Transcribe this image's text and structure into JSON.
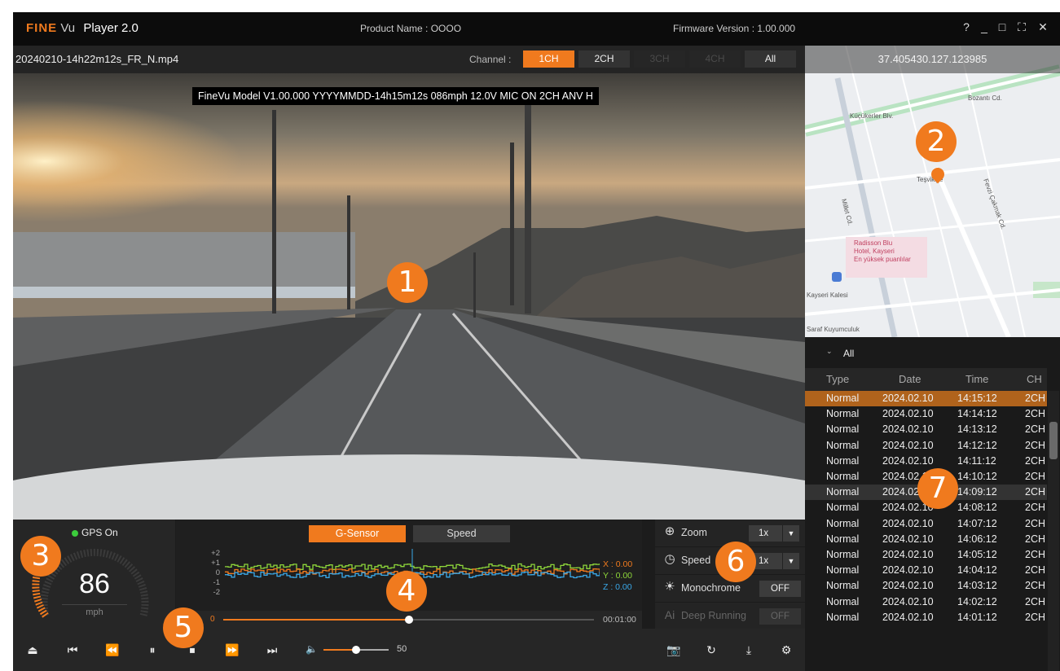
{
  "titlebar": {
    "logo_brand": "FINE",
    "logo_vu": "Vu",
    "app_name": "Player 2.0",
    "product_name": "Product Name : OOOO",
    "firmware": "Firmware Version  : 1.00.000",
    "help": "?",
    "minimize": "_",
    "maximize": "□",
    "fullscreen": "⛶",
    "close": "✕"
  },
  "filebar": {
    "filename": "20240210-14h22m12s_FR_N.mp4",
    "channel_label": "Channel  :",
    "channels": [
      "1CH",
      "2CH",
      "3CH",
      "4CH",
      "All"
    ],
    "active_channel": "1CH"
  },
  "video": {
    "osd_text": "FineVu Model V1.00.000  YYYYMMDD-14h15m12s 086mph 12.0V MIC ON 2CH ANV H"
  },
  "map": {
    "coordinates": "37.405430.127.123985",
    "labels": [
      "Bozantı Cd.",
      "Küçükerler Blv.",
      "Teşvikiye",
      "Radisson Blu",
      "Hotel, Kayseri",
      "En yüksek puanlılar",
      "Kayseri Kalesi",
      "Saraf Kuyumculuk",
      "Millet Cd.",
      "Fevzi Çakmak Cd."
    ]
  },
  "event_list": {
    "filter": "All",
    "filter_icon": "chevron-down-icon",
    "headers": [
      "Type",
      "Date",
      "Time",
      "CH"
    ],
    "rows": [
      [
        "Normal",
        "2024.02.10",
        "14:15:12",
        "2CH"
      ],
      [
        "Normal",
        "2024.02.10",
        "14:14:12",
        "2CH"
      ],
      [
        "Normal",
        "2024.02.10",
        "14:13:12",
        "2CH"
      ],
      [
        "Normal",
        "2024.02.10",
        "14:12:12",
        "2CH"
      ],
      [
        "Normal",
        "2024.02.10",
        "14:11:12",
        "2CH"
      ],
      [
        "Normal",
        "2024.02.10",
        "14:10:12",
        "2CH"
      ],
      [
        "Normal",
        "2024.02.10",
        "14:09:12",
        "2CH"
      ],
      [
        "Normal",
        "2024.02.10",
        "14:08:12",
        "2CH"
      ],
      [
        "Normal",
        "2024.02.10",
        "14:07:12",
        "2CH"
      ],
      [
        "Normal",
        "2024.02.10",
        "14:06:12",
        "2CH"
      ],
      [
        "Normal",
        "2024.02.10",
        "14:05:12",
        "2CH"
      ],
      [
        "Normal",
        "2024.02.10",
        "14:04:12",
        "2CH"
      ],
      [
        "Normal",
        "2024.02.10",
        "14:03:12",
        "2CH"
      ],
      [
        "Normal",
        "2024.02.10",
        "14:02:12",
        "2CH"
      ],
      [
        "Normal",
        "2024.02.10",
        "14:01:12",
        "2CH"
      ]
    ],
    "selected_index": 0
  },
  "gps": {
    "status": "GPS On",
    "status_color": "#3ccc3c",
    "speed": "86",
    "unit": "mph"
  },
  "graph": {
    "tabs": [
      "G-Sensor",
      "Speed"
    ],
    "active_tab": "G-Sensor",
    "y_ticks": [
      "+2",
      "+1",
      "0",
      "-1",
      "-2"
    ],
    "x_value": "X : 0.00",
    "y_value": "Y : 0.00",
    "z_value": "Z : 0.00",
    "colors": {
      "x": "#f07a1e",
      "y": "#8ed63a",
      "z": "#3aa8e8"
    },
    "timeline_start": "0",
    "timeline_end": "00:01:00",
    "progress_fraction": 0.5
  },
  "controls": {
    "eject_icon": "eject-icon",
    "prev_icon": "skip-back-icon",
    "rewind_icon": "rewind-icon",
    "pause_icon": "pause-icon",
    "stop_icon": "stop-icon",
    "forward_icon": "fast-forward-icon",
    "next_icon": "skip-forward-icon",
    "volume_icon": "volume-icon",
    "volume": "50",
    "volume_fraction": 0.5
  },
  "settings": {
    "zoom_label": "Zoom",
    "zoom_value": "1x",
    "speed_label": "Speed",
    "speed_value": "1x",
    "monochrome_label": "Monochrome",
    "monochrome_value": "OFF",
    "deep_running_label": "Deep Running",
    "deep_running_icon_text": "Ai",
    "deep_running_value": "OFF",
    "actions": [
      "camera-icon",
      "rotate-icon",
      "download-icon",
      "gear-icon"
    ]
  },
  "badges": [
    "1",
    "2",
    "3",
    "4",
    "5",
    "6",
    "7"
  ],
  "accent": "#f07a1e"
}
